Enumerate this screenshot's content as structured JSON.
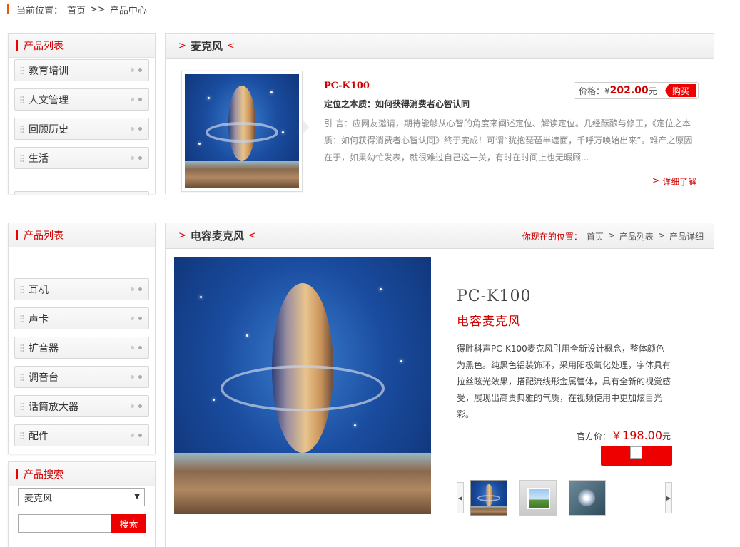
{
  "breadcrumb_top": {
    "prefix": "当前位置：",
    "home": "首页",
    "sep": ">>",
    "current": "产品中心"
  },
  "sidebar1": {
    "title": "产品列表",
    "items": [
      "教育培训",
      "人文管理",
      "回顾历史",
      "生活"
    ]
  },
  "panel1": {
    "title": "麦克风",
    "product": {
      "model": "PC-K100",
      "headline": "定位之本质：如何获得消费者心智认同",
      "price_label": "价格：¥",
      "price": "202.00",
      "price_unit": "元",
      "buy_label": "购买",
      "intro": "引 言：应网友邀请，期待能够从心智的角度来阐述定位、解读定位。几经酝酿与修正，《定位之本质：如何获得消费者心智认同》终于完成！可谓“犹抱琵琶半遮面，千呼万唤始出来”。难产之原因在于，如果匆忙发表，就很难过自己这一关，有时在时间上也无暇顾...",
      "more_label": "详细了解"
    }
  },
  "sidebar2": {
    "title": "产品列表",
    "items": [
      "耳机",
      "声卡",
      "扩音器",
      "调音台",
      "话筒放大器",
      "配件"
    ]
  },
  "sidebar3": {
    "title": "产品搜索",
    "select_value": "麦克风",
    "search_label": "搜索"
  },
  "panel2": {
    "title": "电容麦克风",
    "crumb": {
      "label": "你现在的位置：",
      "items": [
        "首页",
        "产品列表",
        "产品详细"
      ]
    },
    "detail": {
      "model": "PC-K100",
      "name": "电容麦克风",
      "desc": "得胜科声PC-K100麦克风引用全新设计概念，整体颜色为黑色。纯黑色铝装饰环，采用阳极氧化处理，字体具有拉丝眩光效果，搭配流线形金属管体，具有全新的视觉感受，展现出高贵典雅的气质，在视频使用中更加炫目光彩。",
      "price_label": "官方价：",
      "price": "￥198.00",
      "price_unit": "元"
    }
  },
  "colors": {
    "accent": "#d40000",
    "border": "#dddddd"
  }
}
